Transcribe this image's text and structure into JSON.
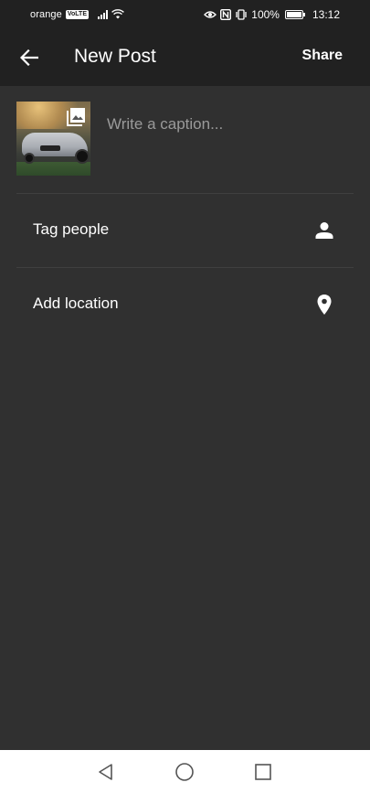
{
  "status_bar": {
    "carrier": "orange",
    "volte": "VoLTE",
    "battery": "100%",
    "battery_level": 1.0,
    "time": "13:12"
  },
  "app_bar": {
    "title": "New Post",
    "share_label": "Share",
    "back_icon": "arrow-left-icon"
  },
  "caption": {
    "placeholder": "Write a caption...",
    "value": "",
    "thumbnail_icon": "gallery-icon"
  },
  "options": [
    {
      "label": "Tag people",
      "icon": "person-icon"
    },
    {
      "label": "Add location",
      "icon": "location-pin-icon"
    }
  ],
  "nav_bar": {
    "back_icon": "nav-back-icon",
    "home_icon": "nav-home-icon",
    "recents_icon": "nav-recents-icon"
  },
  "colors": {
    "background": "#303030",
    "app_bar": "#212121",
    "divider": "#3f3f3f",
    "placeholder": "#9a9a9a",
    "nav_bar": "#ffffff"
  }
}
